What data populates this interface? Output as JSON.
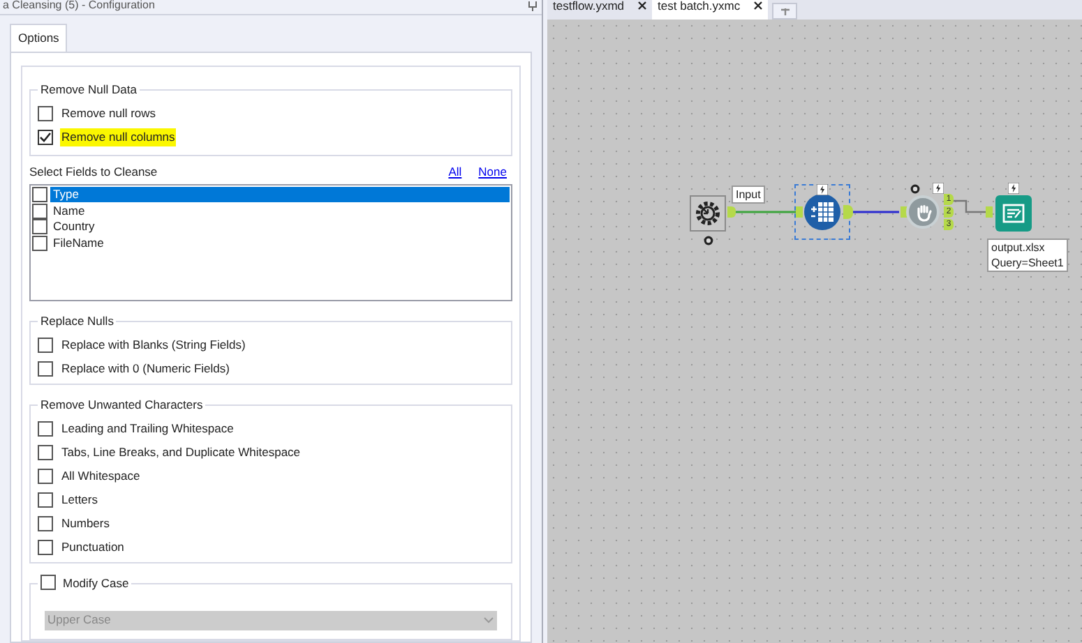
{
  "window": {
    "title": "a Cleansing (5) - Configuration"
  },
  "config_tabs": [
    {
      "label": "Options",
      "selected": true
    }
  ],
  "remove_null": {
    "title": "Remove Null Data",
    "options": [
      {
        "label": "Remove null rows",
        "checked": false,
        "highlighted": false
      },
      {
        "label": "Remove null columns",
        "checked": true,
        "highlighted": true
      }
    ]
  },
  "fields": {
    "title": "Select Fields to Cleanse",
    "links": [
      "All",
      "None"
    ],
    "items": [
      {
        "label": "Type",
        "checked": false,
        "selected": true
      },
      {
        "label": "Name",
        "checked": false,
        "selected": false
      },
      {
        "label": "Country",
        "checked": false,
        "selected": false
      },
      {
        "label": "FileName",
        "checked": false,
        "selected": false
      }
    ]
  },
  "replace_nulls": {
    "title": "Replace Nulls",
    "options": [
      {
        "label": "Replace with Blanks (String Fields)",
        "checked": false
      },
      {
        "label": "Replace with 0 (Numeric Fields)",
        "checked": false
      }
    ]
  },
  "unwanted": {
    "title": "Remove Unwanted Characters",
    "options": [
      {
        "label": "Leading and Trailing Whitespace",
        "checked": false
      },
      {
        "label": "Tabs, Line Breaks, and Duplicate Whitespace",
        "checked": false
      },
      {
        "label": "All Whitespace",
        "checked": false
      },
      {
        "label": "Letters",
        "checked": false
      },
      {
        "label": "Numbers",
        "checked": false
      },
      {
        "label": "Punctuation",
        "checked": false
      }
    ]
  },
  "modify_case": {
    "label": "Modify Case",
    "checked": false,
    "dropdown": {
      "value": "Upper Case",
      "disabled": true
    }
  },
  "doc_tabs": [
    {
      "label": "testflow.yxmd",
      "selected": false
    },
    {
      "label": "test batch.yxmc",
      "selected": true
    }
  ],
  "canvas": {
    "input_label": "Input",
    "anchors": [
      "1",
      "2",
      "3"
    ],
    "output_label": [
      "output.xlsx",
      "Query=Sheet1"
    ]
  }
}
